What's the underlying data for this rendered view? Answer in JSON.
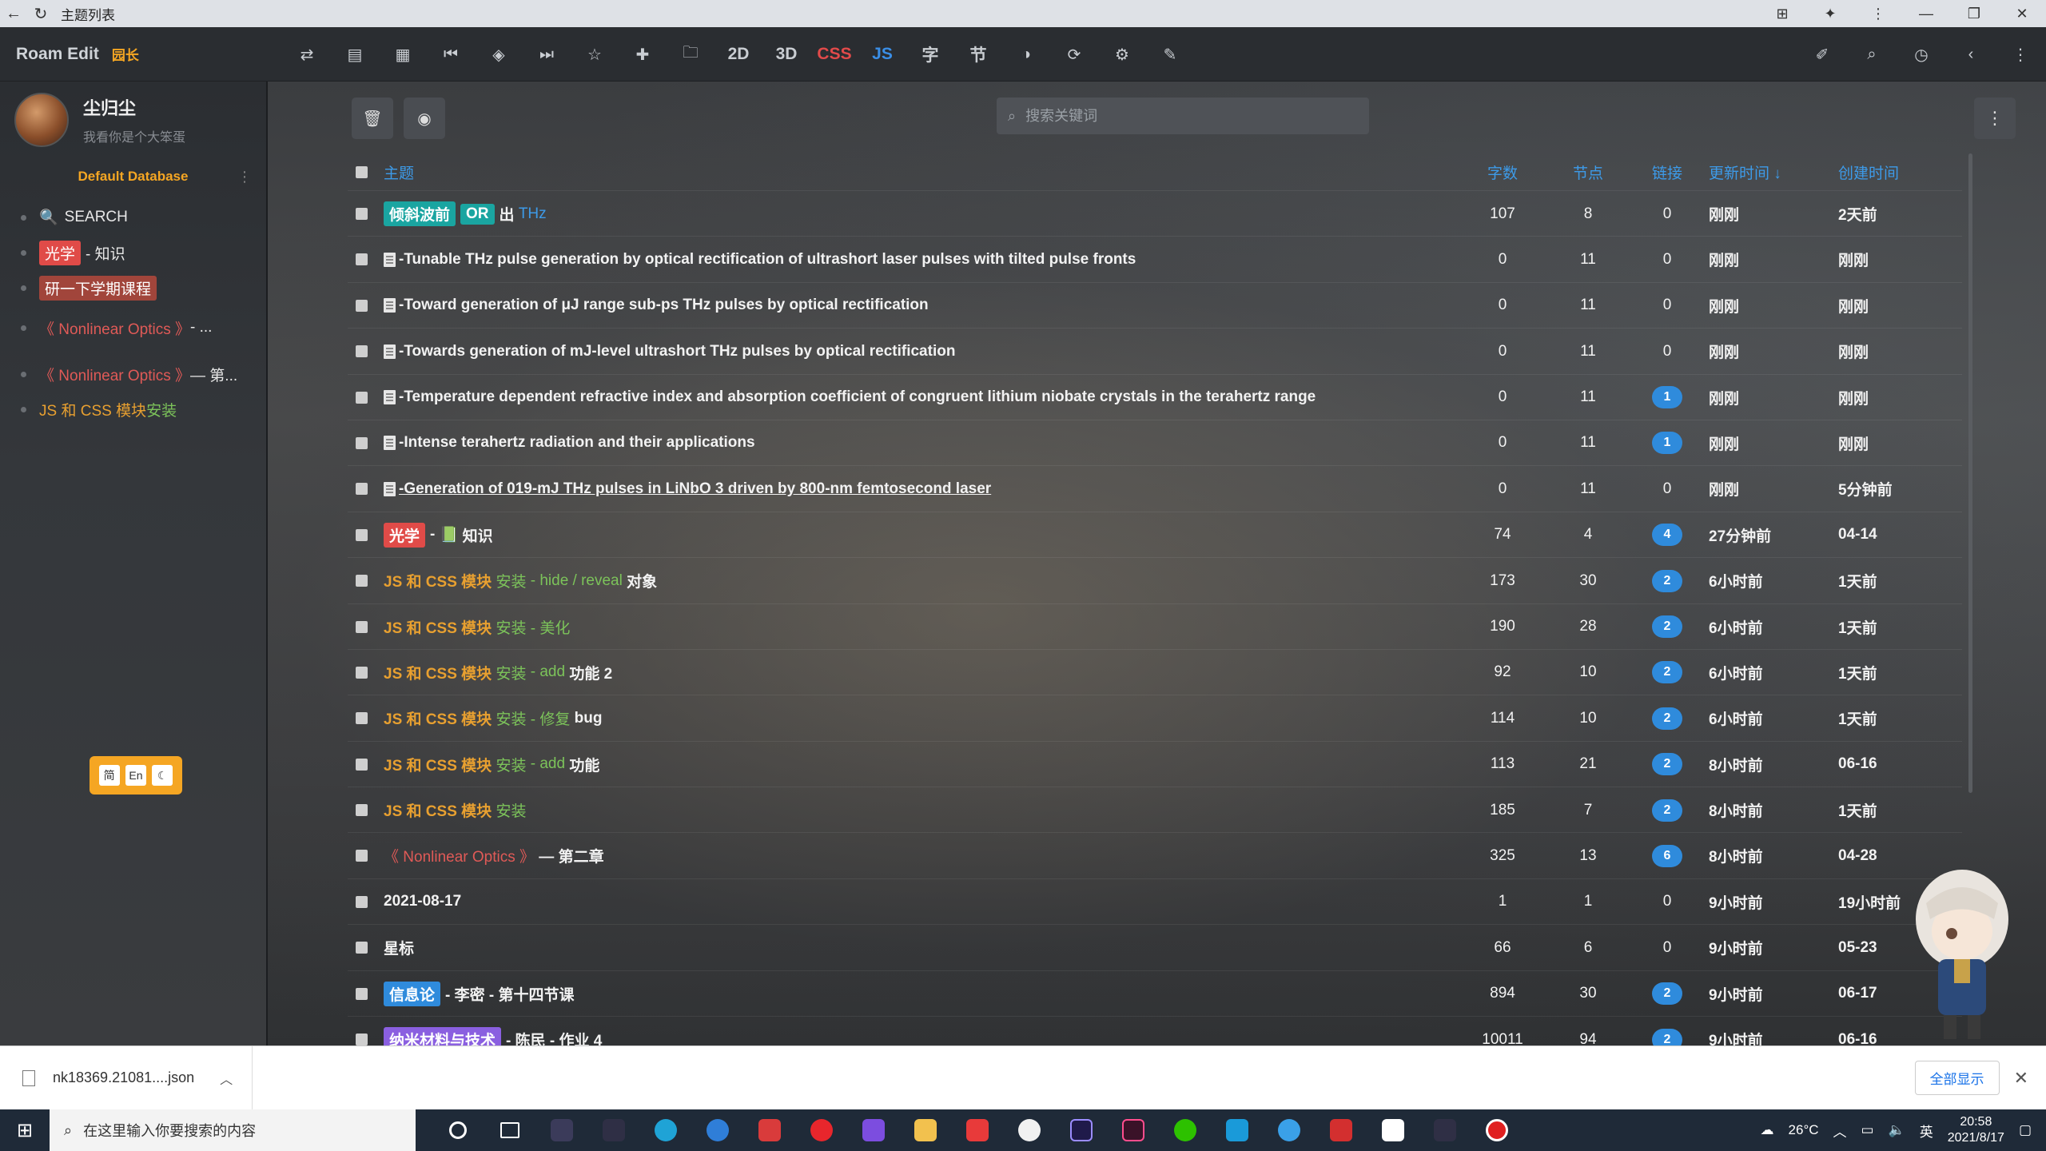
{
  "browser": {
    "title": "主题列表"
  },
  "app": {
    "brand": "Roam Edit",
    "badge": "园长"
  },
  "toolbar": {
    "text_2d": "2D",
    "text_3d": "3D",
    "text_css": "CSS",
    "text_js": "JS",
    "text_zi": "字",
    "text_jie": "节"
  },
  "user": {
    "name": "尘归尘",
    "bio": "我看你是个大笨蛋"
  },
  "database": {
    "name": "Default Database"
  },
  "sidebar": {
    "search": "SEARCH",
    "optics_tag": "光学",
    "optics_rest": "- 知识",
    "course": "研一下学期课程",
    "nlo1_a": "《 Nonlinear Optics 》",
    "nlo1_b": " - ...",
    "nlo2_a": "《 Nonlinear Optics 》",
    "nlo2_b": " — 第...",
    "jscss_a": "JS 和 CSS 模块 ",
    "jscss_b": "安装"
  },
  "lang": {
    "a": "简",
    "b": "En",
    "c": "☾"
  },
  "search": {
    "placeholder": "搜索关键词"
  },
  "table": {
    "headers": {
      "title": "主题",
      "words": "字数",
      "nodes": "节点",
      "links": "链接",
      "updated": "更新时间 ↓",
      "created": "创建时间"
    },
    "rows": [
      {
        "t1": "倾斜波前",
        "t2": "OR",
        "t3": "出",
        "t4": "THz",
        "words": "107",
        "nodes": "8",
        "links": "0",
        "updated": "刚刚",
        "created": "2天前"
      },
      {
        "title": "-Tunable THz pulse generation by optical rectification of ultrashort laser pulses with tilted pulse fronts",
        "words": "0",
        "nodes": "11",
        "links": "0",
        "updated": "刚刚",
        "created": "刚刚"
      },
      {
        "title": "-Toward generation of μJ range sub-ps THz pulses by optical rectification",
        "words": "0",
        "nodes": "11",
        "links": "0",
        "updated": "刚刚",
        "created": "刚刚"
      },
      {
        "title": "-Towards generation of mJ-level ultrashort THz pulses by optical rectification",
        "words": "0",
        "nodes": "11",
        "links": "0",
        "updated": "刚刚",
        "created": "刚刚"
      },
      {
        "title": "-Temperature dependent refractive index and absorption coefficient of congruent lithium niobate crystals in the terahertz range",
        "words": "0",
        "nodes": "11",
        "links": "1",
        "updated": "刚刚",
        "created": "刚刚"
      },
      {
        "title": "-Intense terahertz radiation and their applications",
        "words": "0",
        "nodes": "11",
        "links": "1",
        "updated": "刚刚",
        "created": "刚刚"
      },
      {
        "title": "-Generation of 019-mJ THz pulses in LiNbO 3 driven by 800-nm femtosecond laser",
        "words": "0",
        "nodes": "11",
        "links": "0",
        "updated": "刚刚",
        "created": "5分钟前"
      },
      {
        "t1": "光学",
        "t2": "-",
        "t3": "知识",
        "words": "74",
        "nodes": "4",
        "links": "4",
        "updated": "27分钟前",
        "created": "04-14"
      },
      {
        "t1": "JS 和 CSS 模块",
        "t2": "安装",
        "t3": "- hide / reveal",
        "t4": "对象",
        "words": "173",
        "nodes": "30",
        "links": "2",
        "updated": "6小时前",
        "created": "1天前"
      },
      {
        "t1": "JS 和 CSS 模块",
        "t2": "安装",
        "t3": "- 美化",
        "words": "190",
        "nodes": "28",
        "links": "2",
        "updated": "6小时前",
        "created": "1天前"
      },
      {
        "t1": "JS 和 CSS 模块",
        "t2": "安装",
        "t3": "- add",
        "t4": "功能 2",
        "words": "92",
        "nodes": "10",
        "links": "2",
        "updated": "6小时前",
        "created": "1天前"
      },
      {
        "t1": "JS 和 CSS 模块",
        "t2": "安装",
        "t3": "- 修复",
        "t4": "bug",
        "words": "114",
        "nodes": "10",
        "links": "2",
        "updated": "6小时前",
        "created": "1天前"
      },
      {
        "t1": "JS 和 CSS 模块",
        "t2": "安装",
        "t3": "- add",
        "t4": "功能",
        "words": "113",
        "nodes": "21",
        "links": "2",
        "updated": "8小时前",
        "created": "06-16"
      },
      {
        "t1": "JS 和 CSS 模块",
        "t2": "安装",
        "words": "185",
        "nodes": "7",
        "links": "2",
        "updated": "8小时前",
        "created": "1天前"
      },
      {
        "t1": "《 Nonlinear Optics 》",
        "t2": "— 第二章",
        "words": "325",
        "nodes": "13",
        "links": "6",
        "updated": "8小时前",
        "created": "04-28"
      },
      {
        "title": "2021-08-17",
        "words": "1",
        "nodes": "1",
        "links": "0",
        "updated": "9小时前",
        "created": "19小时前"
      },
      {
        "title": "星标",
        "words": "66",
        "nodes": "6",
        "links": "0",
        "updated": "9小时前",
        "created": "05-23"
      },
      {
        "t1": "信息论",
        "t2": "- 李密 - 第十四节课",
        "words": "894",
        "nodes": "30",
        "links": "2",
        "updated": "9小时前",
        "created": "06-17"
      },
      {
        "t1": "纳米材料与技术",
        "t2": "- 陈民 - 作业 4",
        "words": "10011",
        "nodes": "94",
        "links": "2",
        "updated": "9小时前",
        "created": "06-16"
      }
    ]
  },
  "download": {
    "filename": "nk18369.21081....json",
    "show_all": "全部显示"
  },
  "taskbar": {
    "search_placeholder": "在这里输入你要搜索的内容",
    "weather": "26°C",
    "ime": "英",
    "time": "20:58",
    "date": "2021/8/17"
  }
}
